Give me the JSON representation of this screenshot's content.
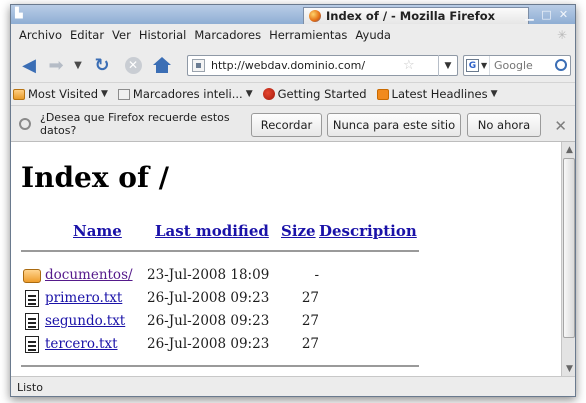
{
  "window": {
    "title": "Index of / - Mozilla Firefox",
    "controls": [
      "minimize-icon",
      "maximize-icon",
      "close-icon"
    ]
  },
  "menu": {
    "items": [
      "Archivo",
      "Editar",
      "Ver",
      "Historial",
      "Marcadores",
      "Herramientas",
      "Ayuda"
    ]
  },
  "navigation": {
    "url": "http://webdav.dominio.com/",
    "search_placeholder": "Google",
    "icons": [
      "back-arrow-icon",
      "forward-arrow-icon",
      "reload-icon",
      "stop-icon",
      "home-icon",
      "bookmark-star-icon",
      "search-icon"
    ]
  },
  "bookmarks": {
    "items": [
      "Most Visited",
      "Marcadores inteli...",
      "Getting Started",
      "Latest Headlines"
    ]
  },
  "password_prompt": {
    "message": "¿Desea que Firefox recuerde estos datos?",
    "remember_label": "Recordar",
    "never_label": "Nunca para este sitio",
    "not_now_label": "No ahora"
  },
  "page": {
    "heading": "Index of /",
    "columns": [
      "Name",
      "Last modified",
      "Size",
      "Description"
    ],
    "entries": [
      {
        "icon": "folder-icon",
        "name": "documentos/",
        "modified": "23-Jul-2008 18:09",
        "size": "-"
      },
      {
        "icon": "text-file-icon",
        "name": "primero.txt",
        "modified": "26-Jul-2008 09:23",
        "size": "27"
      },
      {
        "icon": "text-file-icon",
        "name": "segundo.txt",
        "modified": "26-Jul-2008 09:23",
        "size": "27"
      },
      {
        "icon": "text-file-icon",
        "name": "tercero.txt",
        "modified": "26-Jul-2008 09:23",
        "size": "27"
      }
    ]
  },
  "status": {
    "text": "Listo"
  },
  "colors": {
    "titlebar": "#9db7dc",
    "link_unvisited": "#1a12a8",
    "link_visited": "#551a8b",
    "accent_blue": "#3b6eb5"
  }
}
